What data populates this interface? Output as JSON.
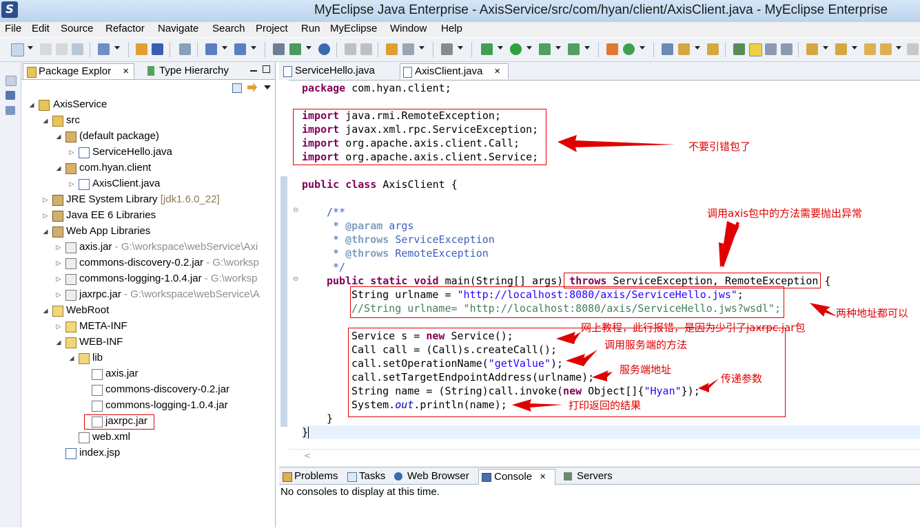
{
  "window": {
    "title": "MyEclipse Java Enterprise - AxisService/src/com/hyan/client/AxisClient.java - MyEclipse Enterprise",
    "logo": "S"
  },
  "menubar": [
    "File",
    "Edit",
    "Source",
    "Refactor",
    "Navigate",
    "Search",
    "Project",
    "Run",
    "MyEclipse",
    "Window",
    "Help"
  ],
  "package_explorer": {
    "tabs": [
      {
        "label": "Package Explor",
        "close": "✕"
      },
      {
        "label": "Type Hierarchy"
      }
    ],
    "tree": [
      {
        "text": "AxisService"
      },
      {
        "text": "src"
      },
      {
        "text": "(default package)"
      },
      {
        "text": "ServiceHello.java"
      },
      {
        "text": "com.hyan.client"
      },
      {
        "text": "AxisClient.java"
      },
      {
        "text": "JRE System Library",
        "decoration": " [jdk1.6.0_22]"
      },
      {
        "text": "Java EE 6 Libraries"
      },
      {
        "text": "Web App Libraries"
      },
      {
        "text": "axis.jar",
        "decoration": " - G:\\workspace\\webService\\Axi"
      },
      {
        "text": "commons-discovery-0.2.jar",
        "decoration": " - G:\\worksp"
      },
      {
        "text": "commons-logging-1.0.4.jar",
        "decoration": " - G:\\worksp"
      },
      {
        "text": "jaxrpc.jar",
        "decoration": " - G:\\workspace\\webService\\A"
      },
      {
        "text": "WebRoot"
      },
      {
        "text": "META-INF"
      },
      {
        "text": "WEB-INF"
      },
      {
        "text": "lib"
      },
      {
        "text": "axis.jar"
      },
      {
        "text": "commons-discovery-0.2.jar"
      },
      {
        "text": "commons-logging-1.0.4.jar"
      },
      {
        "text": "jaxrpc.jar"
      },
      {
        "text": "web.xml"
      },
      {
        "text": "index.jsp"
      }
    ]
  },
  "editor": {
    "tabs": [
      {
        "label": "ServiceHello.java"
      },
      {
        "label": "AxisClient.java",
        "close": "✕"
      }
    ],
    "code": {
      "package_kw": "package",
      "package_name": " com.hyan.client;",
      "import_kw": "import",
      "imports": [
        " java.rmi.RemoteException;",
        " javax.xml.rpc.ServiceException;",
        " org.apache.axis.client.Call;",
        " org.apache.axis.client.Service;"
      ],
      "public_kw": "public",
      "class_kw": "class",
      "class_name": " AxisClient {",
      "jd_open": "/**",
      "jd_star": " * ",
      "param_tag": "@param",
      "param_name": " args",
      "throws_tag": "@throws",
      "throws_1": " ServiceException",
      "throws_2": " RemoteException",
      "jd_close": " */",
      "static_kw": "static",
      "void_kw": "void",
      "main_sig": " main(String[] args) ",
      "throws_kw": "throws",
      "throws_list": " ServiceException, RemoteException",
      "brace_open": " {",
      "urlname_decl": "String urlname = ",
      "urlname_value": "\"http://localhost:8080/axis/ServiceHello.jws\"",
      "semicolon": ";",
      "comment_line": "//String urlname= \"http://localhost:8080/axis/ServiceHello.jws?wsdl\";",
      "service_decl": "Service s = ",
      "new_kw": "new",
      "service_ctor": " Service();",
      "call_line": "Call call = (Call)s.createCall();",
      "setop_pre": "call.setOperationName(",
      "setop_val": "\"getValue\"",
      "setop_post": ");",
      "endpoint_line": "call.setTargetEndpointAddress(urlname);",
      "invoke_pre": "String name = (String)call.invoke(",
      "invoke_mid": " Object[]{",
      "invoke_val": "\"Hyan\"",
      "invoke_post": "});",
      "println_pre": "System.",
      "println_out": "out",
      "println_post": ".println(name);",
      "close_inner": "}",
      "close_outer": "}"
    },
    "annotations": {
      "imports_note": "不要引错包了",
      "throws_note": "调用axis包中的方法需要抛出异常",
      "url_note": "两种地址都可以",
      "jaxrpc_note": "网上教程，此行报错，是因为少引了jaxrpc.jar包",
      "call_note": "调用服务端的方法",
      "endpoint_note": "服务端地址",
      "param_note": "传递参数",
      "print_note": "打印返回的结果"
    }
  },
  "bottom_panel": {
    "tabs": [
      {
        "label": "Problems"
      },
      {
        "label": "Tasks"
      },
      {
        "label": "Web Browser"
      },
      {
        "label": "Console",
        "close": "✕"
      },
      {
        "label": "Servers"
      }
    ],
    "message": "No consoles to display at this time."
  },
  "colors": {
    "keyword": "#7f0055",
    "string": "#2a00ff",
    "javadoc": "#3f5fbf",
    "comment": "#3f7f5f",
    "annotation": "#e00000",
    "panel_bg": "#eef1f6"
  }
}
